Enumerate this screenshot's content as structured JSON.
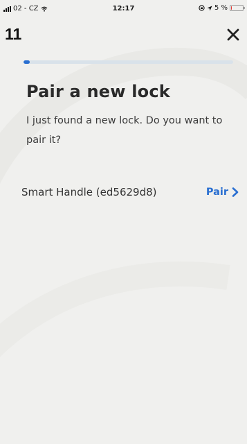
{
  "status_bar": {
    "carrier": "02 - CZ",
    "time": "12:17",
    "battery_percent": "5 %",
    "battery_level": 0.05,
    "signal_icon": "signal-bars-icon",
    "wifi_icon": "wifi-icon",
    "location_icon": "location-arrow-icon",
    "lock_icon": "orientation-lock-icon"
  },
  "header": {
    "step_number": "11",
    "close_icon": "close-icon"
  },
  "progress": {
    "value": 0.03,
    "fill_color": "#2a6fd1",
    "track_color": "#d9e2ea"
  },
  "main": {
    "title": "Pair a new lock",
    "subtitle": "I just found a new lock. Do you want to pair it?"
  },
  "lock": {
    "name": "Smart Handle (ed5629d8)",
    "action_label": "Pair",
    "action_icon": "chevron-right-icon",
    "accent_color": "#2a6fd1"
  }
}
